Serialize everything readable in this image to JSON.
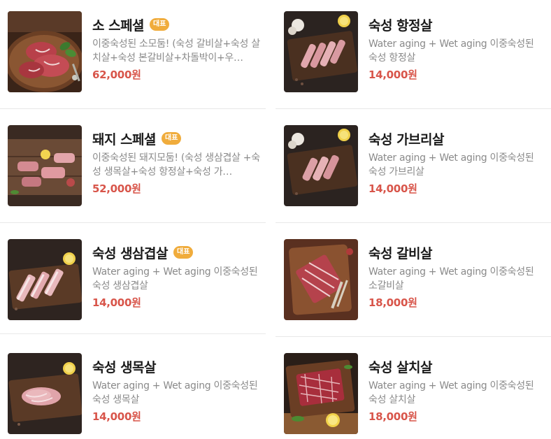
{
  "menu": {
    "items": [
      {
        "name": "소 스페셜",
        "badge": "대표",
        "description": "이중숙성된 소모둠! (숙성 갈비살+숙성 살치살+숙성 본갈비살+차돌박이+우…",
        "price": "62,000원",
        "image": "beef-platter-photo"
      },
      {
        "name": "숙성 항정살",
        "badge": "",
        "description": "Water aging + Wet aging 이중숙성된 숙성 항정살",
        "price": "14,000원",
        "image": "pork-jowl-photo"
      },
      {
        "name": "돼지 스페셜",
        "badge": "대표",
        "description": "이중숙성된 돼지모둠! (숙성 생삼겹살 +숙성 생목살+숙성 항정살+숙성 가…",
        "price": "52,000원",
        "image": "pork-platter-photo"
      },
      {
        "name": "숙성 가브리살",
        "badge": "",
        "description": "Water aging + Wet aging 이중숙성된 숙성 가브리살",
        "price": "14,000원",
        "image": "pork-neck-photo"
      },
      {
        "name": "숙성 생삼겹살",
        "badge": "대표",
        "description": "Water aging + Wet aging 이중숙성된 숙성 생삼겹살",
        "price": "14,000원",
        "image": "pork-belly-photo"
      },
      {
        "name": "숙성 갈비살",
        "badge": "",
        "description": "Water aging + Wet aging 이중숙성된 소갈비살",
        "price": "18,000원",
        "image": "beef-rib-photo"
      },
      {
        "name": "숙성 생목살",
        "badge": "",
        "description": "Water aging + Wet aging 이중숙성된 숙성 생목살",
        "price": "14,000원",
        "image": "pork-shoulder-photo"
      },
      {
        "name": "숙성 살치살",
        "badge": "",
        "description": "Water aging + Wet aging 이중숙성된 숙성 살치살",
        "price": "18,000원",
        "image": "beef-chuck-flap-photo"
      }
    ]
  },
  "colors": {
    "price": "#d8554a",
    "badge_bg": "#f0ac3c",
    "name": "#1a1a1a",
    "description": "#8a8a8a",
    "divider": "#e8e8e8"
  }
}
